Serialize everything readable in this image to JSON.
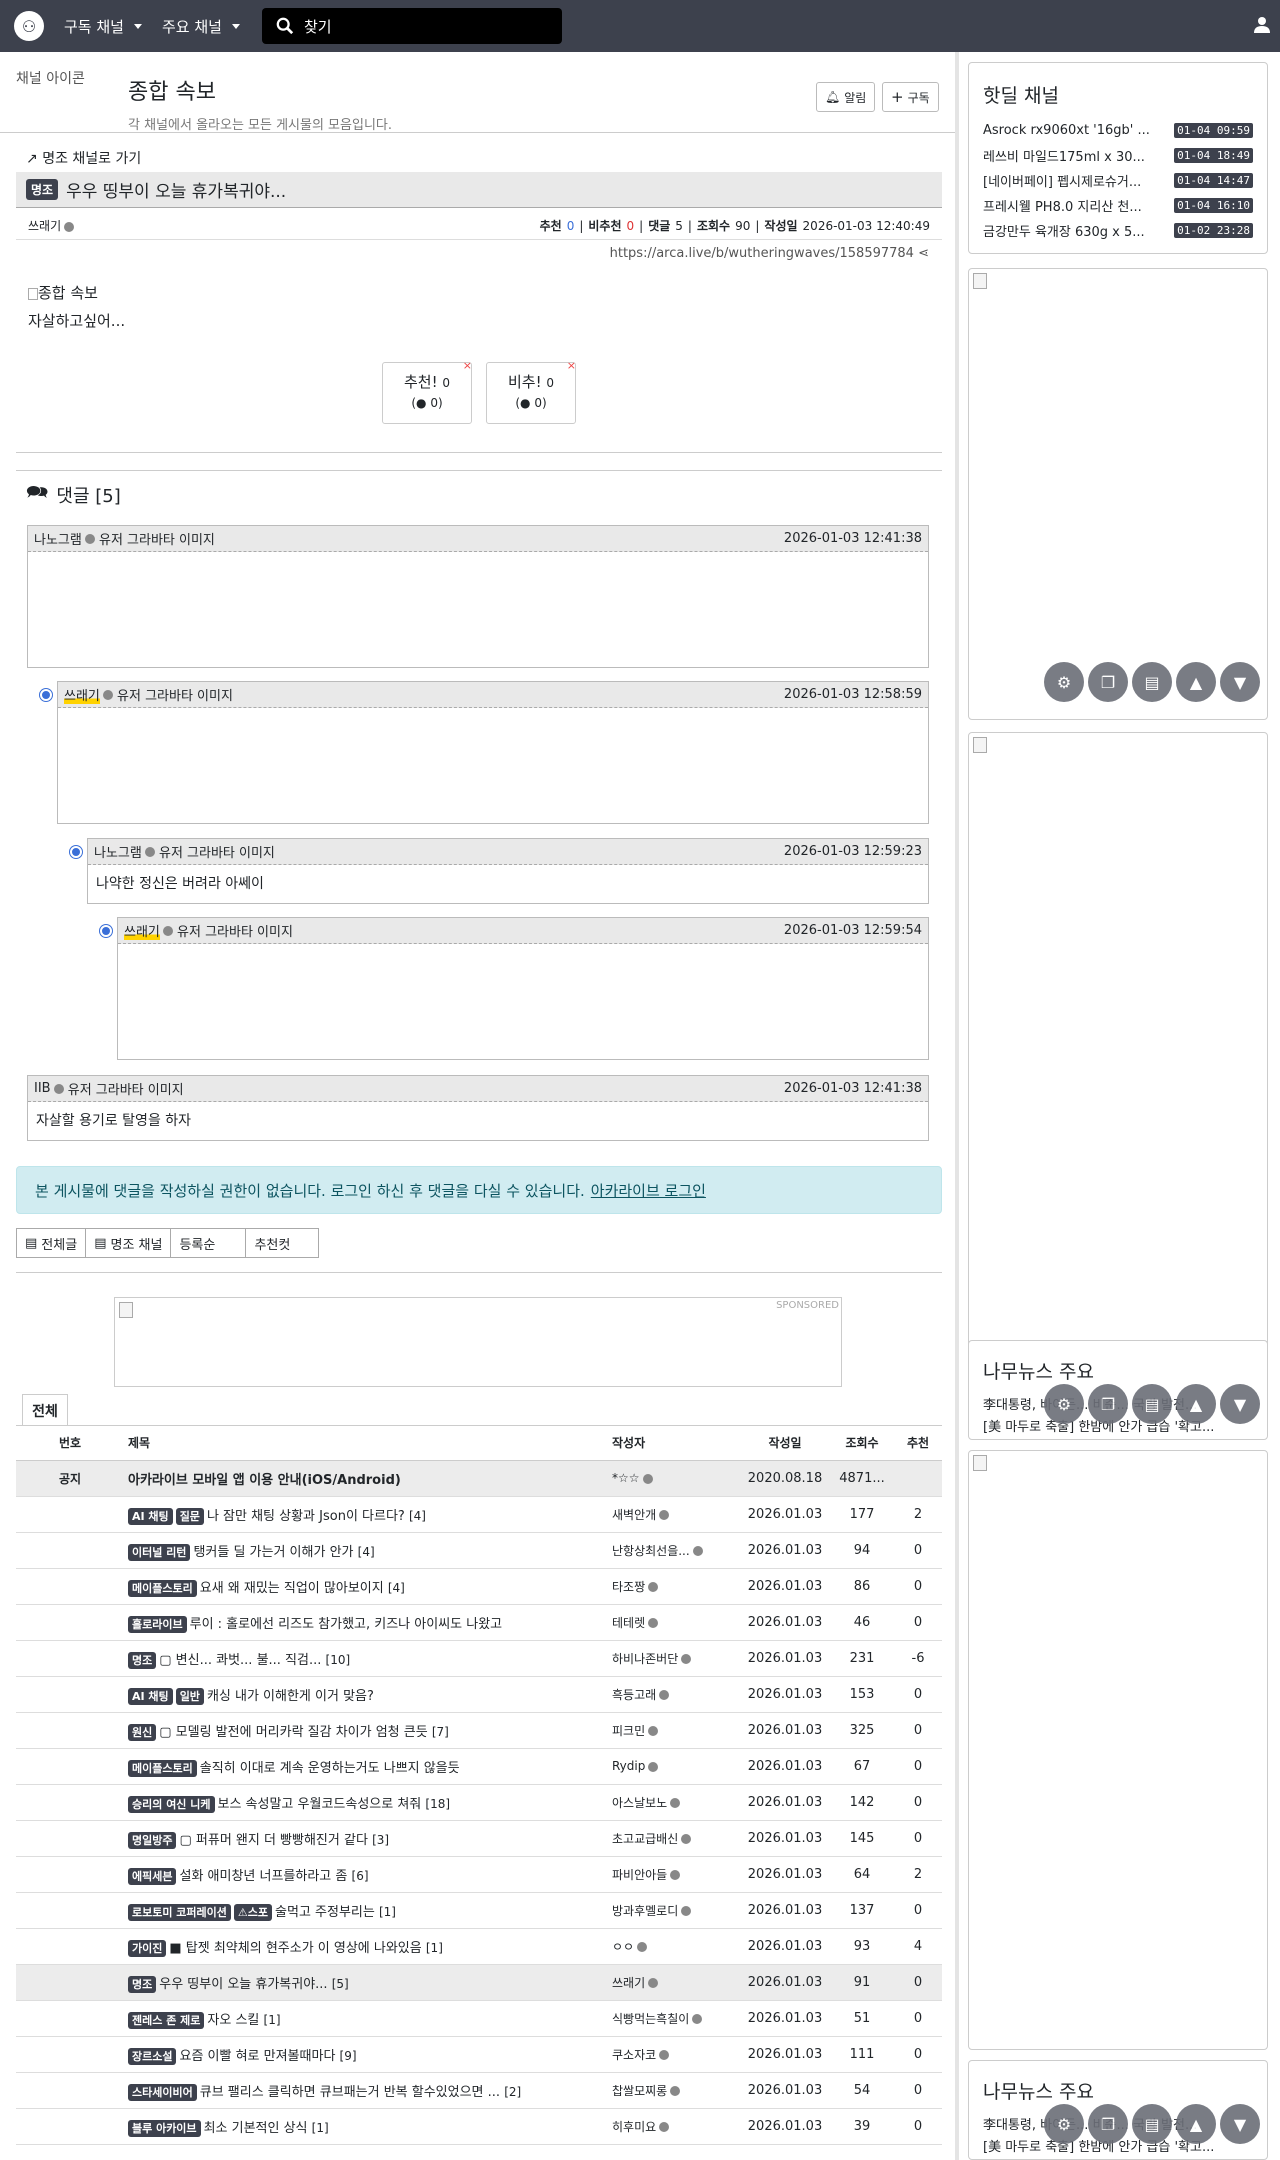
{
  "nav": {
    "subscribed": "구독 채널",
    "major": "주요 채널",
    "search_placeholder": "찾기"
  },
  "channel": {
    "icon_alt": "채널 아이콘",
    "title": "종합 속보",
    "description": "각 채널에서 올라오는 모든 게시물의 모음입니다.",
    "notify": "알림",
    "subscribe": "구독"
  },
  "post": {
    "back": "명조 채널로 가기",
    "category": "명조",
    "title": "우우 띵부이 오늘 휴가복귀야...",
    "author": "쓰래기",
    "labels": {
      "up": "추천",
      "down": "비추천",
      "comments": "댓글",
      "views": "조회수",
      "date": "작성일"
    },
    "up": "0",
    "down": "0",
    "comments": "5",
    "views": "90",
    "date": "2026-01-03 12:40:49",
    "url": "https://arca.live/b/wutheringwaves/158597784",
    "image_alt": "종합 속보",
    "body": "자살하고싶어..."
  },
  "votes": {
    "up_label": "추천!",
    "up": "0",
    "up_sub": "0",
    "down_label": "비추!",
    "down": "0",
    "down_sub": "0"
  },
  "comments": {
    "heading": "댓글 [5]",
    "avatar_alt": "유저 그라바타 이미지",
    "items": [
      {
        "author": "나노그램",
        "date": "2026-01-03 12:41:38",
        "text": ""
      },
      {
        "author": "쓰래기",
        "date": "2026-01-03 12:58:59",
        "text": ""
      },
      {
        "author": "나노그램",
        "date": "2026-01-03 12:59:23",
        "text": "나약한 정신은 버려라 아쎄이"
      },
      {
        "author": "쓰래기",
        "date": "2026-01-03 12:59:54",
        "text": ""
      },
      {
        "author": "IIB",
        "date": "2026-01-03 12:41:38",
        "text": "자살할 용기로 탈영을 하자"
      }
    ]
  },
  "alert": {
    "text": "본 게시물에 댓글을 작성하실 권한이 없습니다. 로그인 하신 후 댓글을 다실 수 있습니다.",
    "link": "아카라이브 로그인"
  },
  "filter": {
    "all": "전체글",
    "channel": "명조 채널",
    "sort": "등록순",
    "best": "추천컷"
  },
  "ad": {
    "label": "SPONSORED"
  },
  "list": {
    "tab": "전체",
    "headers": [
      "번호",
      "제목",
      "작성자",
      "작성일",
      "조회수",
      "추천"
    ],
    "notice": {
      "no": "공지",
      "title": "아카라이브 모바일 앱 이용 안내(iOS/Android)",
      "author": "*☆☆",
      "date": "2020.08.18",
      "views": "4871...",
      "up": ""
    },
    "rows": [
      {
        "cat": "AI 채팅",
        "sub": "질문",
        "title": "나 잠만 채팅 상황과 Json이 다르다?",
        "cmt": "[4]",
        "author": "새벽안개",
        "date": "2026.01.03",
        "views": "177",
        "up": "2"
      },
      {
        "cat": "이터널 리턴",
        "sub": "",
        "title": "탱커들 딜 가는거 이해가 안가",
        "cmt": "[4]",
        "author": "난항상최선을...",
        "date": "2026.01.03",
        "views": "94",
        "up": "0"
      },
      {
        "cat": "메이플스토리",
        "sub": "",
        "title": "요새 왜 재밌는 직업이 많아보이지",
        "cmt": "[4]",
        "author": "타조짱",
        "date": "2026.01.03",
        "views": "86",
        "up": "0"
      },
      {
        "cat": "홀로라이브",
        "sub": "",
        "title": "루이 : 홀로에선 리즈도 참가했고, 키즈나 아이씨도 나왔고",
        "cmt": "",
        "author": "테테렛",
        "date": "2026.01.03",
        "views": "46",
        "up": "0"
      },
      {
        "cat": "명조",
        "sub": "",
        "title": "▢ 변신... 콰벗... 불... 직검...",
        "cmt": "[10]",
        "author": "하비나존버단",
        "date": "2026.01.03",
        "views": "231",
        "up": "-6"
      },
      {
        "cat": "AI 채팅",
        "sub": "일반",
        "title": "캐싱 내가 이해한게 이거 맞음?",
        "cmt": "",
        "author": "흑등고래",
        "date": "2026.01.03",
        "views": "153",
        "up": "0"
      },
      {
        "cat": "원신",
        "sub": "",
        "title": "▢ 모델링 발전에 머리카락 질감 차이가 엄청 큰듯",
        "cmt": "[7]",
        "author": "피크민",
        "date": "2026.01.03",
        "views": "325",
        "up": "0"
      },
      {
        "cat": "메이플스토리",
        "sub": "",
        "title": "솔직히 이대로 계속 운영하는거도 나쁘지 않을듯",
        "cmt": "",
        "author": "Rydip",
        "date": "2026.01.03",
        "views": "67",
        "up": "0"
      },
      {
        "cat": "승리의 여신 니케",
        "sub": "",
        "title": "보스 속성말고 우월코드속성으로 쳐줘",
        "cmt": "[18]",
        "author": "아스날보노",
        "date": "2026.01.03",
        "views": "142",
        "up": "0"
      },
      {
        "cat": "명일방주",
        "sub": "",
        "title": "▢ 퍼퓨머 왠지 더 빵빵해진거 같다",
        "cmt": "[3]",
        "author": "초고교급배신",
        "date": "2026.01.03",
        "views": "145",
        "up": "0"
      },
      {
        "cat": "에픽세븐",
        "sub": "",
        "title": "설화 애미창년 너프를하라고 좀",
        "cmt": "[6]",
        "author": "파비안아들",
        "date": "2026.01.03",
        "views": "64",
        "up": "2"
      },
      {
        "cat": "로보토미 코퍼레이션",
        "sub": "⚠스포",
        "title": "술먹고 주정부리는",
        "cmt": "[1]",
        "author": "방과후멜로디",
        "date": "2026.01.03",
        "views": "137",
        "up": "0"
      },
      {
        "cat": "가이진",
        "sub": "",
        "title": "■ 탑젯 최약체의 현주소가 이 영상에 나와있음",
        "cmt": "[1]",
        "author": "ㅇㅇ",
        "date": "2026.01.03",
        "views": "93",
        "up": "4"
      },
      {
        "cat": "명조",
        "sub": "",
        "title": "우우 띵부이 오늘 휴가복귀야...",
        "cmt": "[5]",
        "author": "쓰래기",
        "date": "2026.01.03",
        "views": "91",
        "up": "0",
        "current": true
      },
      {
        "cat": "젠레스 존 제로",
        "sub": "",
        "title": "자오 스킬",
        "cmt": "[1]",
        "author": "식빵먹는흑칠이",
        "date": "2026.01.03",
        "views": "51",
        "up": "0"
      },
      {
        "cat": "장르소설",
        "sub": "",
        "title": "요즘 이빨 혀로 만져볼때마다",
        "cmt": "[9]",
        "author": "쿠소자코",
        "date": "2026.01.03",
        "views": "111",
        "up": "0"
      },
      {
        "cat": "스타세이비어",
        "sub": "",
        "title": "큐브 팰리스 클릭하면 큐브패는거 반복 할수있었으면 ...",
        "cmt": "[2]",
        "author": "찹쌀모찌롱",
        "date": "2026.01.03",
        "views": "54",
        "up": "0"
      },
      {
        "cat": "블루 아카이브",
        "sub": "",
        "title": "최소 기본적인 상식",
        "cmt": "[1]",
        "author": "히후미요",
        "date": "2026.01.03",
        "views": "39",
        "up": "0"
      }
    ]
  },
  "hotdeal": {
    "title": "핫딜 채널",
    "items": [
      {
        "name": "Asrock rx9060xt '16gb' ...",
        "date": "01-04 09:59"
      },
      {
        "name": "레쓰비 마일드175ml x 30...",
        "date": "01-04 18:49"
      },
      {
        "name": "[네이버페이] 펩시제로슈거...",
        "date": "01-04 14:47"
      },
      {
        "name": "프레시웰 PH8.0 지리산 천...",
        "date": "01-04 16:10"
      },
      {
        "name": "금강만두 육개장 630g x 5...",
        "date": "01-02 23:28"
      }
    ]
  },
  "news": {
    "title": "나무뉴스 주요",
    "lines": [
      "李대통령, 바이든... 비준... 국방 발전...",
      "[美 마두로 축출] 한밤에 안가 급습 '확고..."
    ]
  }
}
